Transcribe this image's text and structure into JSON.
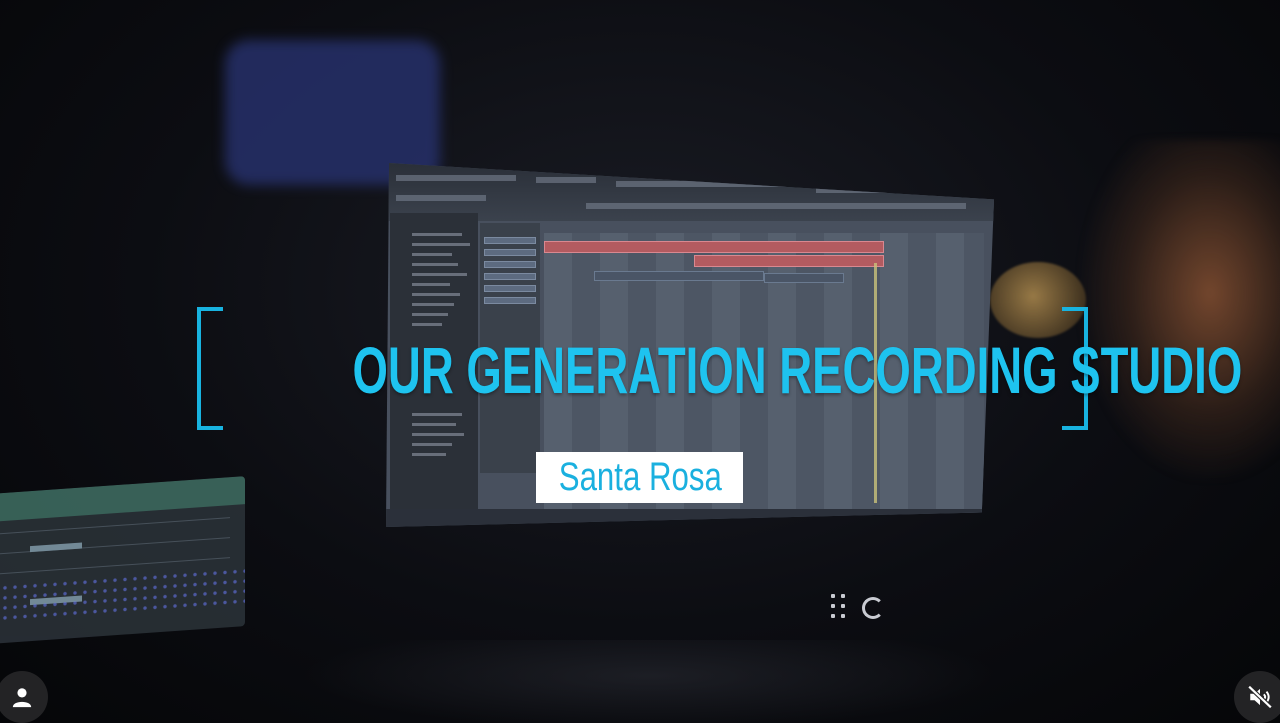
{
  "overlay": {
    "title": "OUR GENERATION RECORDING STUDIO",
    "subtitle": "Santa Rosa"
  },
  "controls": {
    "profile_icon": "person-icon",
    "mute_icon": "speaker-muted-icon"
  },
  "colors": {
    "accent": "#1ec3ef",
    "subtitle_bg": "#ffffff",
    "background": "#0a0b10"
  }
}
